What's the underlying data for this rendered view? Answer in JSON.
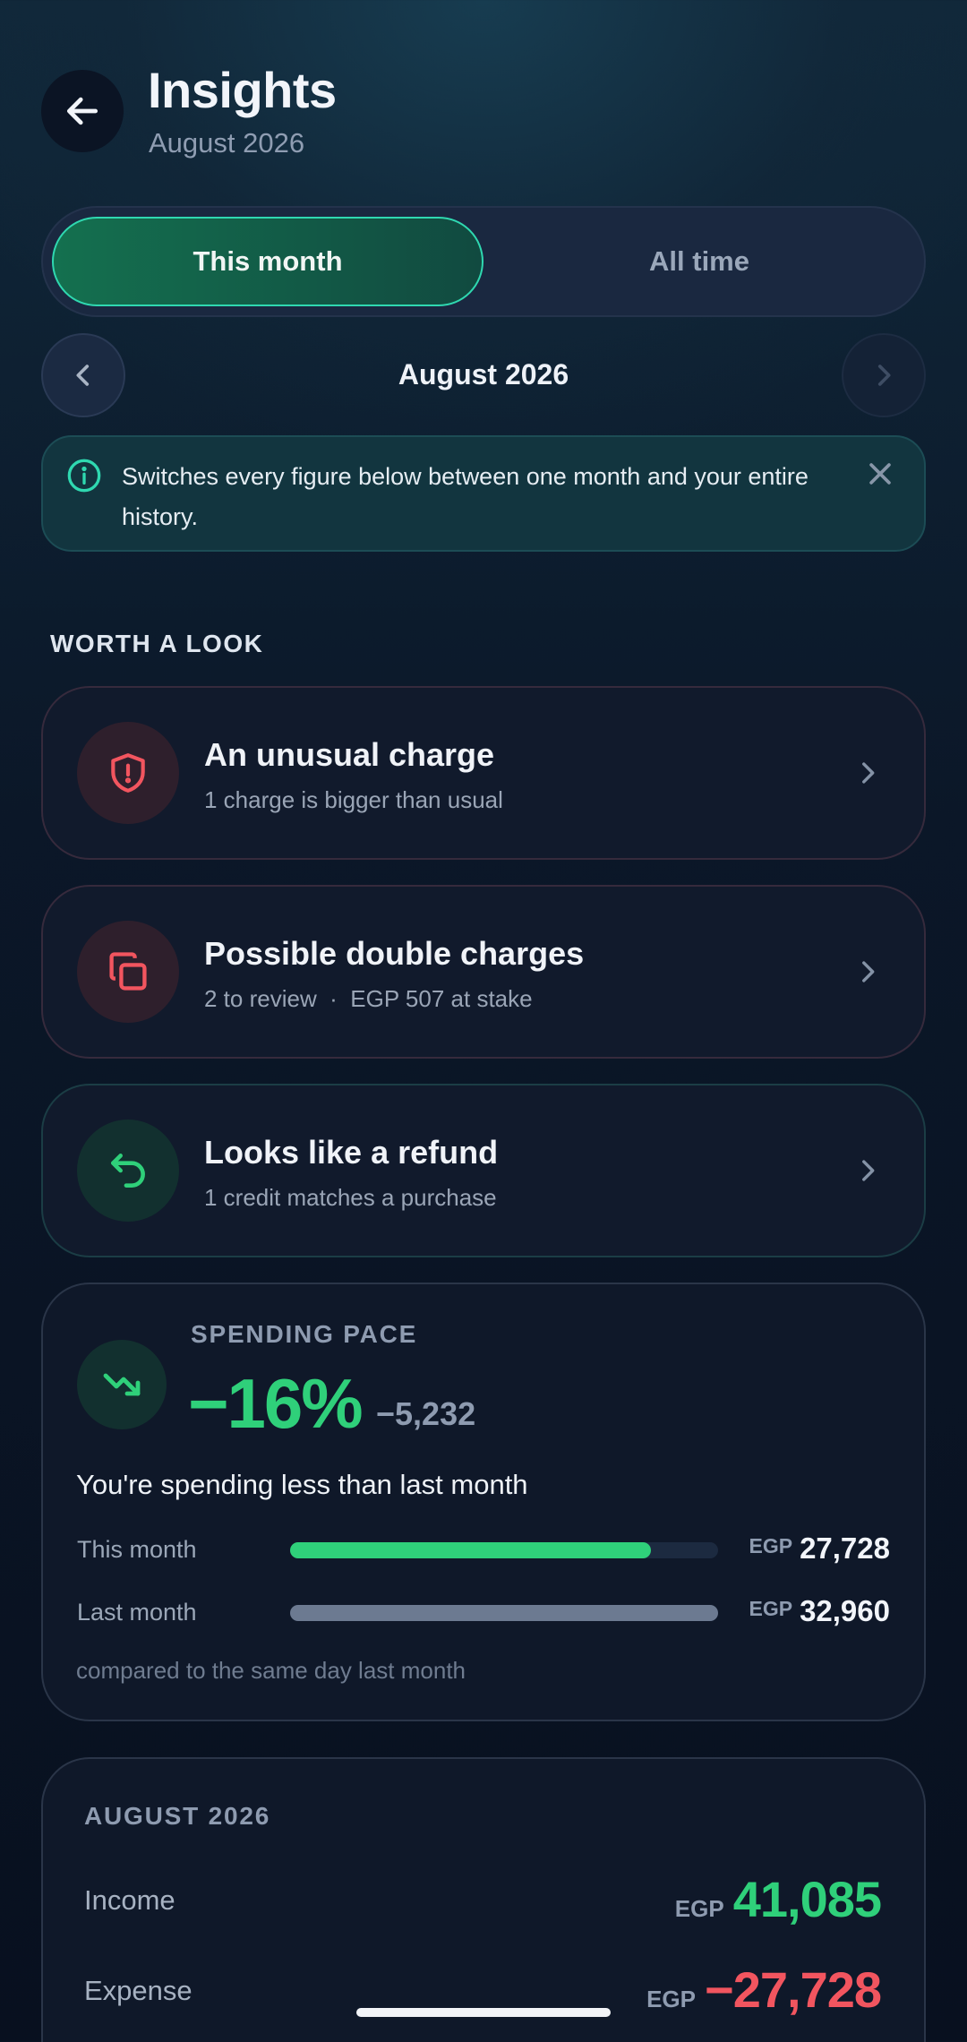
{
  "header": {
    "title": "Insights",
    "subtitle": "August 2026"
  },
  "segment": {
    "active_label": "This month",
    "inactive_label": "All time"
  },
  "month_nav": {
    "label": "August 2026"
  },
  "info_banner": {
    "text": "Switches every figure below between one month and your entire history."
  },
  "section": {
    "label": "WORTH A LOOK"
  },
  "alerts": [
    {
      "title": "An unusual charge",
      "subtitle": "1 charge is bigger than usual",
      "icon": "shield-alert-icon",
      "tone": "red"
    },
    {
      "title": "Possible double charges",
      "subtitle": "2 to review  ·  EGP 507 at stake",
      "icon": "duplicate-icon",
      "tone": "red"
    },
    {
      "title": "Looks like a refund",
      "subtitle": "1 credit matches a purchase",
      "icon": "refund-arrow-icon",
      "tone": "green"
    }
  ],
  "pace": {
    "label": "SPENDING PACE",
    "percent": "−16%",
    "difference": "−5,232",
    "message": "You're spending less than last month",
    "rows": [
      {
        "label": "This month",
        "currency": "EGP",
        "value": "27,728",
        "fill": 0.843
      },
      {
        "label": "Last month",
        "currency": "EGP",
        "value": "32,960",
        "fill": 1.0
      }
    ],
    "footnote": "compared to the same day last month"
  },
  "summary": {
    "label": "AUGUST 2026",
    "income_label": "Income",
    "income_currency": "EGP",
    "income_value": "41,085",
    "expense_label": "Expense",
    "expense_currency": "EGP",
    "expense_value": "−27,728"
  },
  "colors": {
    "positive": "#2fd07a",
    "negative": "#f2555f",
    "accent_teal": "#2fd8b0",
    "bar_last_month": "#6c7a91"
  }
}
